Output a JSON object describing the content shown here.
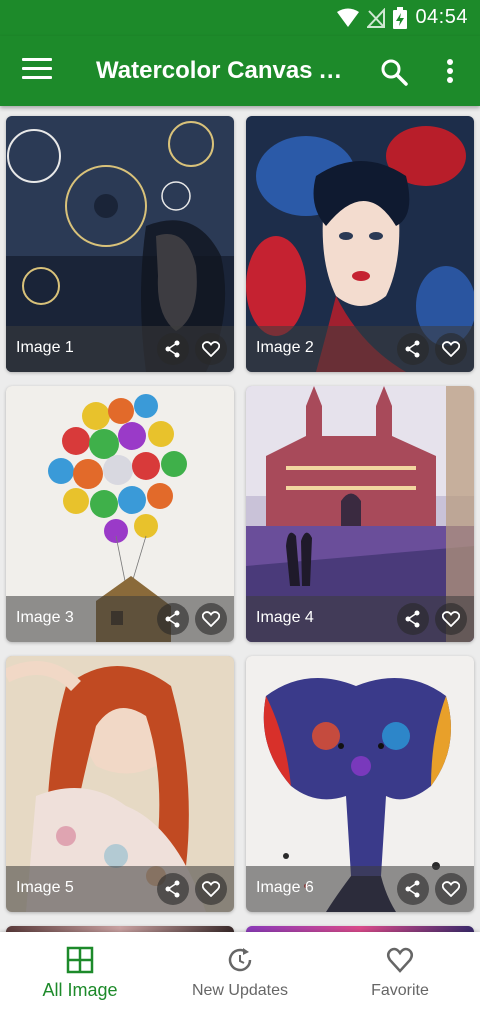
{
  "status_bar": {
    "time": "04:54"
  },
  "app_bar": {
    "title": "Watercolor Canvas Art Ideas"
  },
  "images": [
    {
      "label": "Image 1"
    },
    {
      "label": "Image 2"
    },
    {
      "label": "Image 3"
    },
    {
      "label": "Image 4"
    },
    {
      "label": "Image 5"
    },
    {
      "label": "Image 6"
    }
  ],
  "bottom_nav": {
    "items": [
      {
        "label": "All Image",
        "icon": "grid-icon",
        "active": true
      },
      {
        "label": "New Updates",
        "icon": "refresh-icon",
        "active": false
      },
      {
        "label": "Favorite",
        "icon": "heart-icon",
        "active": false
      }
    ]
  },
  "colors": {
    "primary": "#1d8a2a",
    "nav_inactive": "#666666"
  }
}
